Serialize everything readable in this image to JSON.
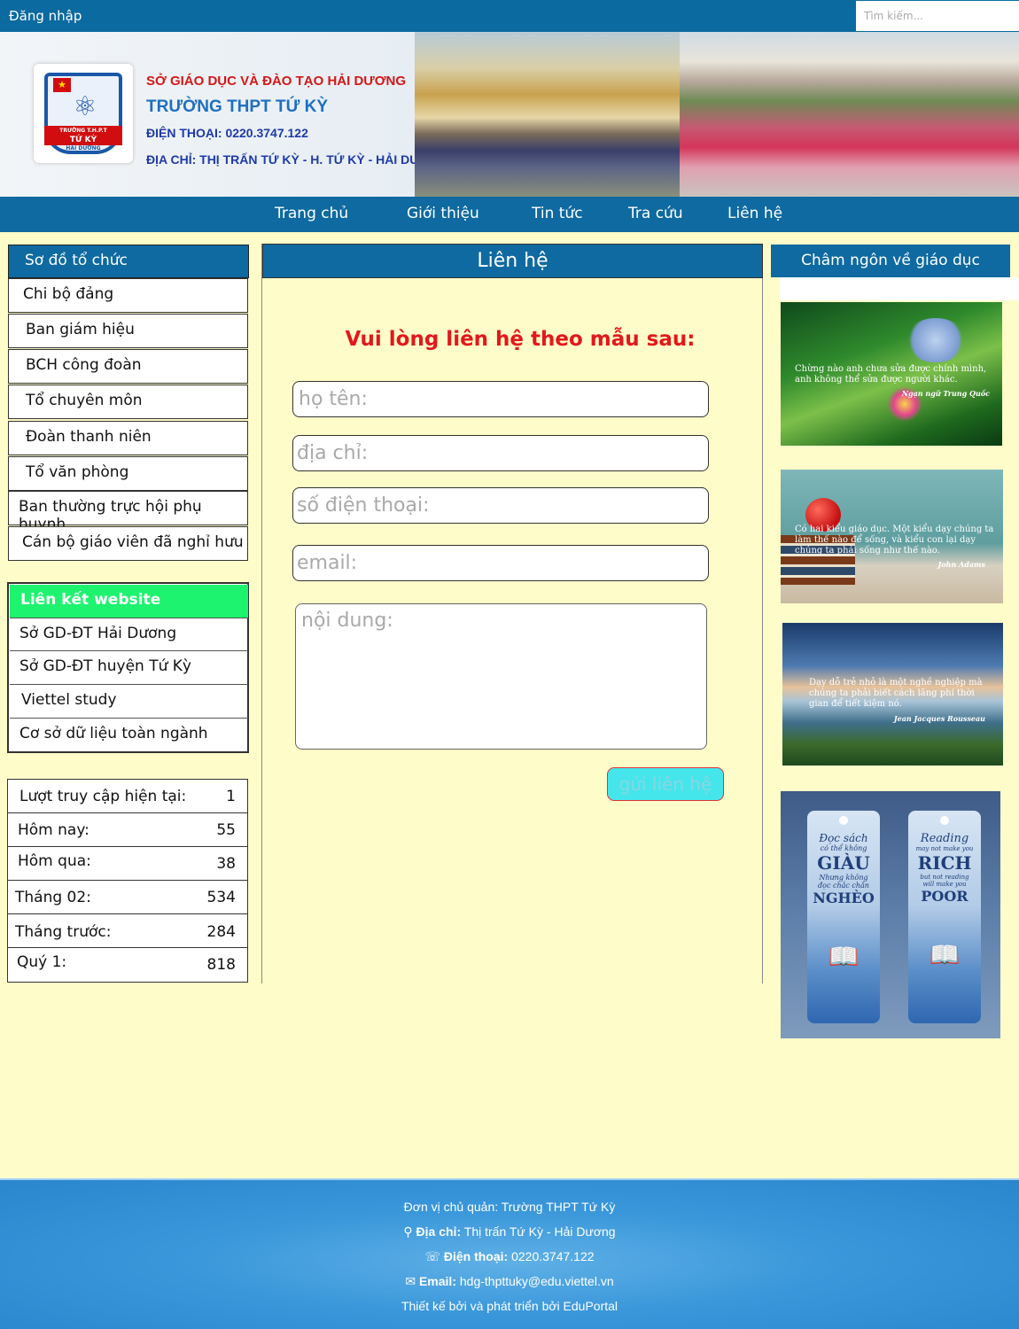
{
  "topbar": {
    "login_label": "Đăng nhập",
    "search_placeholder": "Tìm kiếm..."
  },
  "banner": {
    "line1": "SỞ GIÁO DỤC VÀ ĐÀO TẠO HẢI DƯƠNG",
    "line2": "TRƯỜNG THPT TỨ KỲ",
    "line3": "ĐIỆN THOẠI: 0220.3747.122",
    "line4": "ĐỊA CHỈ: THỊ TRẤN TỨ KỲ - H. TỨ KỲ - HẢI DƯƠNG",
    "logo_top": "TRƯỜNG T.H.P.T",
    "logo_name": "TỨ KỲ",
    "logo_bottom": "HẢI DƯƠNG"
  },
  "nav": [
    "Trang chủ",
    "Giới thiệu",
    "Tin tức",
    "Tra cứu",
    "Liên hệ"
  ],
  "left": {
    "org_title": "Sơ đồ tổ chức",
    "org_items": [
      "Chi bộ đảng",
      "Ban giám hiệu",
      "BCH công đoàn",
      "Tổ chuyên môn",
      "Đoàn thanh niên",
      "Tổ văn phòng",
      "Ban thường trực hội phụ huynh",
      "Cán bộ giáo viên đã nghỉ hưu"
    ],
    "links_title": "Liên kết website",
    "links": [
      "Sở GD-ĐT Hải Dương",
      "Sở GD-ĐT huyện Tứ Kỳ",
      "Viettel study",
      "Cơ sở dữ liệu toàn ngành"
    ],
    "stats": [
      {
        "label": "Lượt truy cập hiện tại:",
        "value": "1"
      },
      {
        "label": "Hôm nay:",
        "value": "55"
      },
      {
        "label": "Hôm qua:",
        "value": "38"
      },
      {
        "label": "Tháng 02:",
        "value": "534"
      },
      {
        "label": "Tháng trước:",
        "value": "284"
      },
      {
        "label": "Quý 1:",
        "value": "818"
      }
    ]
  },
  "contact": {
    "title": "Liên hệ",
    "heading": "Vui lòng liên hệ theo mẫu sau:",
    "name_placeholder": "họ tên:",
    "address_placeholder": "địa chỉ:",
    "phone_placeholder": "số điện thoại:",
    "email_placeholder": "email:",
    "content_placeholder": "nội dung:",
    "submit_label": "gửi liên hệ"
  },
  "right": {
    "title": "Châm ngôn về giáo dục",
    "quotes": [
      {
        "text": "Chừng nào anh chưa sửa được chính mình, anh không thể sửa được người khác.",
        "author": "Ngạn ngữ Trung Quốc"
      },
      {
        "text": "Có hai kiểu giáo dục. Một kiểu dạy chúng ta làm thế nào để sống, và kiểu con lại dạy chúng ta phải sống như thế nào.",
        "author": "John Adams"
      },
      {
        "text": "Dạy dỗ trẻ nhỏ là một nghề nghiệp mà chúng ta phải biết cách lãng phí thời gian để tiết kiệm nó.",
        "author": "Jean Jacques Rousseau"
      }
    ],
    "bookmark_vi": {
      "l1": "Đọc sách",
      "l2": "có thể không",
      "l3": "GIÀU",
      "l4": "Nhưng không",
      "l5": "đọc chắc chắn",
      "l6": "NGHÈO"
    },
    "bookmark_en": {
      "l1": "Reading",
      "l2": "may not make you",
      "l3": "RICH",
      "l4": "but not reading",
      "l5": "will make you",
      "l6": "POOR"
    }
  },
  "footer": {
    "unit": "Đơn vị chủ quản: Trường THPT Tứ Kỳ",
    "address_label": "Địa chỉ:",
    "address": "Thị trấn Tứ Kỳ - Hải Dương",
    "phone_label": "Điện thoại:",
    "phone": "0220.3747.122",
    "email_label": "Email:",
    "email": "hdg-thpttuky@edu.viettel.vn",
    "credit": "Thiết kế bởi và phát triển bởi EduPortal"
  },
  "colors": {
    "primary_blue": "#0e6aa0",
    "page_bg": "#fefcc9",
    "link_header_green": "#1df36f",
    "heading_red": "#e2181b",
    "footer_blue": "#3a97da"
  },
  "icons": {
    "address": "map-pin-icon",
    "phone": "phone-icon",
    "email": "envelope-icon"
  }
}
